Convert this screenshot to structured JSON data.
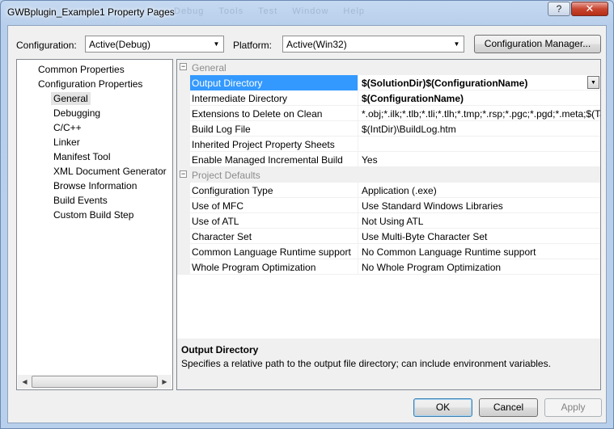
{
  "window": {
    "title": "GWBplugin_Example1 Property Pages",
    "ghost_menu": [
      "Debug",
      "Tools",
      "Test",
      "Window",
      "Help"
    ],
    "help_glyph": "?",
    "close_glyph": "✕"
  },
  "toolbar": {
    "configuration_label": "Configuration:",
    "configuration_value": "Active(Debug)",
    "platform_label": "Platform:",
    "platform_value": "Active(Win32)",
    "config_manager_label": "Configuration Manager..."
  },
  "tree": {
    "items": [
      {
        "label": "Common Properties",
        "level": 0,
        "selected": false
      },
      {
        "label": "Configuration Properties",
        "level": 0,
        "selected": false
      },
      {
        "label": "General",
        "level": 1,
        "selected": true
      },
      {
        "label": "Debugging",
        "level": 1,
        "selected": false
      },
      {
        "label": "C/C++",
        "level": 1,
        "selected": false
      },
      {
        "label": "Linker",
        "level": 1,
        "selected": false
      },
      {
        "label": "Manifest Tool",
        "level": 1,
        "selected": false
      },
      {
        "label": "XML Document Generator",
        "level": 1,
        "selected": false
      },
      {
        "label": "Browse Information",
        "level": 1,
        "selected": false
      },
      {
        "label": "Build Events",
        "level": 1,
        "selected": false
      },
      {
        "label": "Custom Build Step",
        "level": 1,
        "selected": false
      }
    ]
  },
  "grid": {
    "sections": [
      {
        "title": "General",
        "rows": [
          {
            "name": "Output Directory",
            "value": "$(SolutionDir)$(ConfigurationName)",
            "bold": true,
            "selected": true
          },
          {
            "name": "Intermediate Directory",
            "value": "$(ConfigurationName)",
            "bold": true,
            "selected": false
          },
          {
            "name": "Extensions to Delete on Clean",
            "value": "*.obj;*.ilk;*.tlb;*.tli;*.tlh;*.tmp;*.rsp;*.pgc;*.pgd;*.meta;$(TargetPath)",
            "bold": false,
            "selected": false
          },
          {
            "name": "Build Log File",
            "value": "$(IntDir)\\BuildLog.htm",
            "bold": false,
            "selected": false
          },
          {
            "name": "Inherited Project Property Sheets",
            "value": "",
            "bold": false,
            "selected": false
          },
          {
            "name": "Enable Managed Incremental Build",
            "value": "Yes",
            "bold": false,
            "selected": false
          }
        ]
      },
      {
        "title": "Project Defaults",
        "rows": [
          {
            "name": "Configuration Type",
            "value": "Application (.exe)",
            "bold": false,
            "selected": false
          },
          {
            "name": "Use of MFC",
            "value": "Use Standard Windows Libraries",
            "bold": false,
            "selected": false
          },
          {
            "name": "Use of ATL",
            "value": "Not Using ATL",
            "bold": false,
            "selected": false
          },
          {
            "name": "Character Set",
            "value": "Use Multi-Byte Character Set",
            "bold": false,
            "selected": false
          },
          {
            "name": "Common Language Runtime support",
            "value": "No Common Language Runtime support",
            "bold": false,
            "selected": false
          },
          {
            "name": "Whole Program Optimization",
            "value": "No Whole Program Optimization",
            "bold": false,
            "selected": false
          }
        ]
      }
    ],
    "collapse_glyph": "−"
  },
  "description": {
    "title": "Output Directory",
    "text": "Specifies a relative path to the output file directory; can include environment variables."
  },
  "buttons": {
    "ok": "OK",
    "cancel": "Cancel",
    "apply": "Apply"
  }
}
